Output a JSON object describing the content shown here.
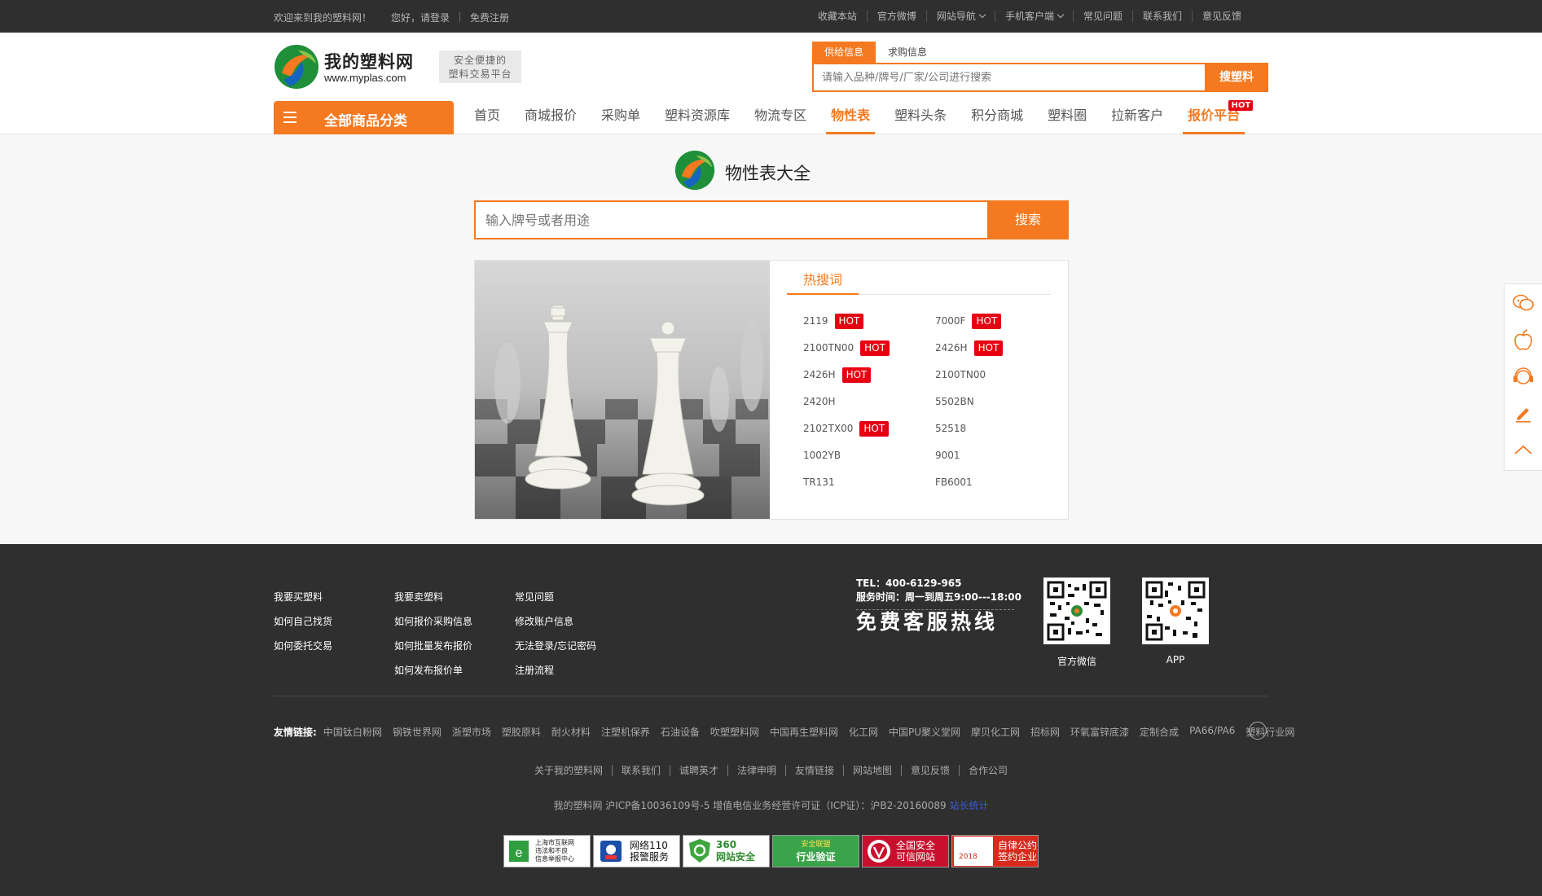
{
  "topbar": {
    "welcome": "欢迎来到我的塑料网！",
    "login": "您好，请登录",
    "register": "免费注册",
    "links": [
      "收藏本站",
      "官方微博",
      "网站导航",
      "手机客户端",
      "常见问题",
      "联系我们",
      "意见反馈"
    ]
  },
  "header": {
    "brand": "我的塑料网",
    "url": "www.myplas.com",
    "slogan_line1": "安全便捷的",
    "slogan_line2": "塑料交易平台",
    "search_tabs": [
      "供给信息",
      "求购信息"
    ],
    "search_placeholder": "请输入品种/牌号/厂家/公司进行搜索",
    "search_button": "搜塑料",
    "category_button": "全部商品分类",
    "nav": [
      "首页",
      "商城报价",
      "采购单",
      "塑料资源库",
      "物流专区",
      "物性表",
      "塑料头条",
      "积分商城",
      "塑料圈",
      "拉新客户",
      "报价平台"
    ],
    "nav_hot": "HOT"
  },
  "main": {
    "title": "物性表大全",
    "search_placeholder": "输入牌号或者用途",
    "search_button": "搜索",
    "hot_title": "热搜词",
    "hot_badge": "HOT",
    "hot_words": [
      {
        "text": "2119",
        "hot": true
      },
      {
        "text": "7000F",
        "hot": true
      },
      {
        "text": "2100TN00",
        "hot": true
      },
      {
        "text": "2426H",
        "hot": true
      },
      {
        "text": "2426H",
        "hot": true
      },
      {
        "text": "2100TN00",
        "hot": false
      },
      {
        "text": "2420H",
        "hot": false
      },
      {
        "text": "5502BN",
        "hot": false
      },
      {
        "text": "2102TX00",
        "hot": true
      },
      {
        "text": "52518",
        "hot": false
      },
      {
        "text": "1002YB",
        "hot": false
      },
      {
        "text": "9001",
        "hot": false
      },
      {
        "text": "TR131",
        "hot": false
      },
      {
        "text": "FB6001",
        "hot": false
      }
    ]
  },
  "footer": {
    "col1": [
      "我要买塑料",
      "如何自己找货",
      "如何委托交易"
    ],
    "col2": [
      "我要卖塑料",
      "如何报价采购信息",
      "如何批量发布报价",
      "如何发布报价单"
    ],
    "col3": [
      "常见问题",
      "修改账户信息",
      "无法登录/忘记密码",
      "注册流程"
    ],
    "tel": "TEL：400-6129-965",
    "service_time": "服务时间：周一到周五9:00---18:00",
    "hotline": "免费客服热线",
    "qr1_caption": "官方微信",
    "qr2_caption": "APP",
    "friend_label": "友情链接:",
    "friend_links": [
      "中国钛白粉网",
      "钢铁世界网",
      "浙塑市场",
      "塑胶原料",
      "耐火材料",
      "注塑机保养",
      "石油设备",
      "吹塑塑料网",
      "中国再生塑料网",
      "化工网",
      "中国PU聚义堂网",
      "摩贝化工网",
      "招标网",
      "环氧富锌底漆",
      "定制合成",
      "PA66/PA6",
      "塑料行业网"
    ],
    "bottom_nav": [
      "关于我的塑料网",
      "联系我们",
      "诚聘英才",
      "法律申明",
      "友情链接",
      "网站地图",
      "意见反馈",
      "合作公司"
    ],
    "icp": "我的塑料网 沪ICP备10036109号-5 增值电信业务经营许可证（ICP证）：沪B2-20160089",
    "icp_link": "站长统计",
    "badges": [
      {
        "line1": "上海市互联网",
        "line2": "违法和不良",
        "line3": "信息举报中心"
      },
      {
        "line1": "网络110",
        "line2": "报警服务"
      },
      {
        "line1": "360",
        "line2": "网站安全"
      },
      {
        "line1": "安全联盟",
        "line2": "行业验证"
      },
      {
        "line1": "全国安全",
        "line2": "可信网站"
      },
      {
        "line1": "自律公约",
        "line2": "签约企业",
        "line3": "2018"
      }
    ]
  },
  "colors": {
    "accent": "#f47920",
    "hot": "#e60012",
    "dark": "#2f2f2f"
  }
}
